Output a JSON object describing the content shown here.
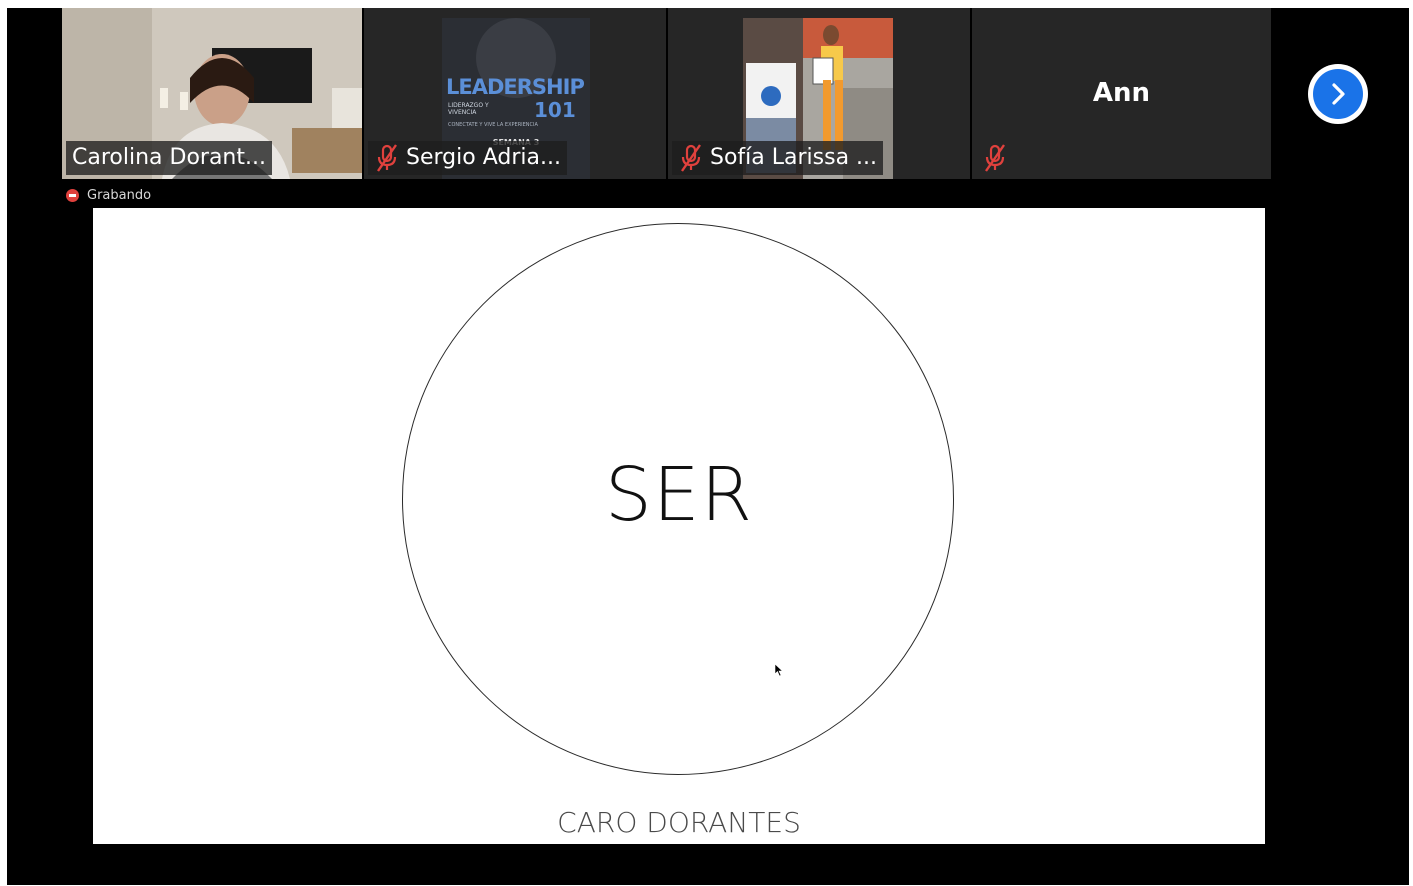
{
  "participants": [
    {
      "name": "Carolina Dorant...",
      "muted": false,
      "active_speaker": true
    },
    {
      "name": "Sergio Adria...",
      "muted": true,
      "background_text": {
        "title": "LEADERSHIP",
        "number": "101",
        "subtitle": "LIDERAZGO Y VIVENCIA",
        "tagline": "CONECTATE Y VIVE LA EXPERIENCIA",
        "week": "SEMANA 3"
      }
    },
    {
      "name": "Sofía Larissa ...",
      "muted": true
    },
    {
      "name": "Ann",
      "muted": true,
      "video_off": true
    }
  ],
  "recording": {
    "label": "Grabando"
  },
  "slide": {
    "main_word": "SER",
    "footer_brand": "CARO DORANTES"
  },
  "colors": {
    "background": "#000000",
    "tile_bg": "#262626",
    "active_speaker_border": "#8dc63f",
    "muted_icon": "#e0413d",
    "next_button": "#1a73e8"
  },
  "icons": [
    "muted-mic-icon",
    "chevron-right-icon",
    "recording-dot-icon",
    "mouse-pointer-icon"
  ]
}
